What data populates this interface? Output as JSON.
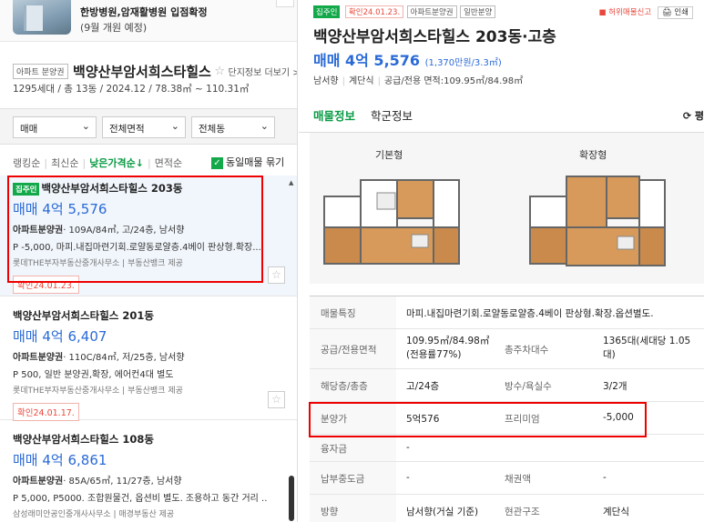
{
  "promo": {
    "title": "한방병원,암재활병원 입점확정",
    "subtitle": "(9월 개원 예정)"
  },
  "complex": {
    "tag": "아파트 분양권",
    "name": "백양산부암서희스타힐스",
    "star": "☆",
    "more": "단지정보 더보기 >",
    "info": "1295세대 / 총 13동 / 2024.12 / 78.38㎡ ~ 110.31㎡"
  },
  "filters": {
    "trade": "매매",
    "area": "전체면적",
    "dong": "전체동"
  },
  "sorts": [
    "랭킹순",
    "최신순",
    "낮은가격순↓",
    "면적순"
  ],
  "same_listing": {
    "label": "동일매물 묶기",
    "checked": true
  },
  "listings": [
    {
      "badge": "집주인",
      "title": "백양산부암서희스타힐스 203동",
      "price": "매매 4억 5,576",
      "detail_type": "아파트분양권",
      "detail": "· 109A/84㎡, 고/24층, 남서향",
      "desc": "P -5,000, 마피.내집마련기회.로얄동로얄층.4베이 판상형.확장...",
      "agent": "롯데THE부자부동산중개사무소 | 부동산뱅크 제공",
      "confirm": "확인24.01.23.",
      "selected": true
    },
    {
      "badge": "",
      "title": "백양산부암서희스타힐스 201동",
      "price": "매매 4억 6,407",
      "detail_type": "아파트분양권",
      "detail": "· 110C/84㎡, 저/25층, 남서향",
      "desc": "P 500, 일반 분양권,확장, 에어컨4대 별도",
      "agent": "롯데THE부자부동산중개사무소 | 부동산뱅크 제공",
      "confirm": "확인24.01.17.",
      "selected": false
    },
    {
      "badge": "",
      "title": "백양산부암서희스타힐스 108동",
      "price": "매매 4억 6,861",
      "detail_type": "아파트분양권",
      "detail": "· 85A/65㎡, 11/27층, 남서향",
      "desc": "P 5,000, P5000. 조합원물건, 옵션비 별도. 조용하고 동간 거리 ...",
      "agent": "삼성래미안공인중개사사무소 | 매경부동산 제공",
      "confirm": "",
      "selected": false
    }
  ],
  "fav_icon": "☆",
  "detail": {
    "tags": [
      "집주인",
      "확인24.01.23.",
      "아파트분양권",
      "일반분양"
    ],
    "report": "■ 허위매물신고",
    "print": "🖨 인쇄",
    "title": "백양산부암서희스타힐스 203동·고층",
    "price": "매매 4억 5,576",
    "price_unit": "(1,370만원/3.3㎡)",
    "sub": [
      "남서향",
      "계단식",
      "공급/전용 면적:109.95㎡/84.98㎡"
    ],
    "tabs": [
      "매물정보",
      "학군정보"
    ],
    "tab_right": "⟳ 평",
    "floorplans": [
      "기본형",
      "확장형"
    ],
    "rows": [
      {
        "k": "매물특징",
        "v": "마피.내집마련기회.로얄동로얄층.4베이 판상형.확장.옵션별도.",
        "k2": "",
        "v2": ""
      },
      {
        "k": "공급/전용면적",
        "v": "109.95㎡/84.98㎡(전용률77%)",
        "k2": "총주차대수",
        "v2": "1365대(세대당 1.05대)"
      },
      {
        "k": "해당층/총층",
        "v": "고/24층",
        "k2": "방수/욕실수",
        "v2": "3/2개"
      },
      {
        "k": "분양가",
        "v": "5억576",
        "k2": "프리미엄",
        "v2": "-5,000"
      },
      {
        "k": "융자금",
        "v": "-",
        "k2": "",
        "v2": ""
      },
      {
        "k": "납부중도금",
        "v": "-",
        "k2": "채권액",
        "v2": "-"
      },
      {
        "k": "방향",
        "v": "남서향(거실 기준)",
        "k2": "현관구조",
        "v2": "계단식"
      }
    ]
  }
}
